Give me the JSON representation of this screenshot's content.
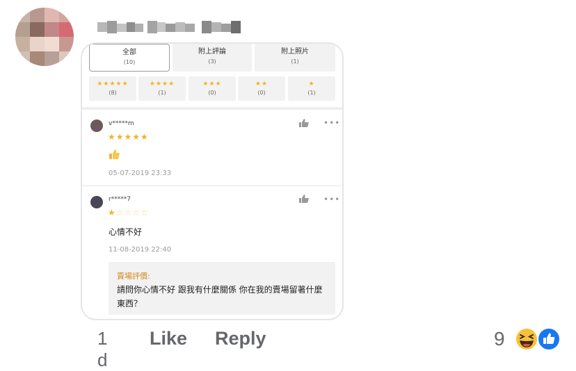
{
  "comment": {
    "time": "1 d",
    "like_label": "Like",
    "reply_label": "Reply",
    "reaction_count": "9",
    "reactions": [
      "haha-icon",
      "like-icon"
    ]
  },
  "screenshot": {
    "tabs": [
      {
        "label": "全部",
        "count": "(10)",
        "active": true
      },
      {
        "label": "附上評論",
        "count": "(3)",
        "active": false
      },
      {
        "label": "附上照片",
        "count": "(1)",
        "active": false
      }
    ],
    "star_filters": [
      {
        "stars": "★★★★★",
        "count": "(8)"
      },
      {
        "stars": "★★★★",
        "count": "(1)"
      },
      {
        "stars": "★★★",
        "count": "(0)"
      },
      {
        "stars": "★★",
        "count": "(0)"
      },
      {
        "stars": "★",
        "count": "(1)"
      }
    ],
    "reviews": [
      {
        "user": "v*****m",
        "rating": 5,
        "emoji": "thumbs-up",
        "date": "05-07-2019 23:33"
      },
      {
        "user": "r*****7",
        "rating": 1,
        "text": "心情不好",
        "date": "11-08-2019 22:40"
      }
    ],
    "seller_reply": {
      "label": "賣場評價:",
      "text": "請問你心情不好 跟我有什麼關係 你在我的賣場留著什麼東西？"
    },
    "colors": {
      "star": "#f0b428",
      "seller_label": "#d18a1a",
      "fb_grey": "#65676b",
      "fb_blue": "#1877f2"
    }
  }
}
